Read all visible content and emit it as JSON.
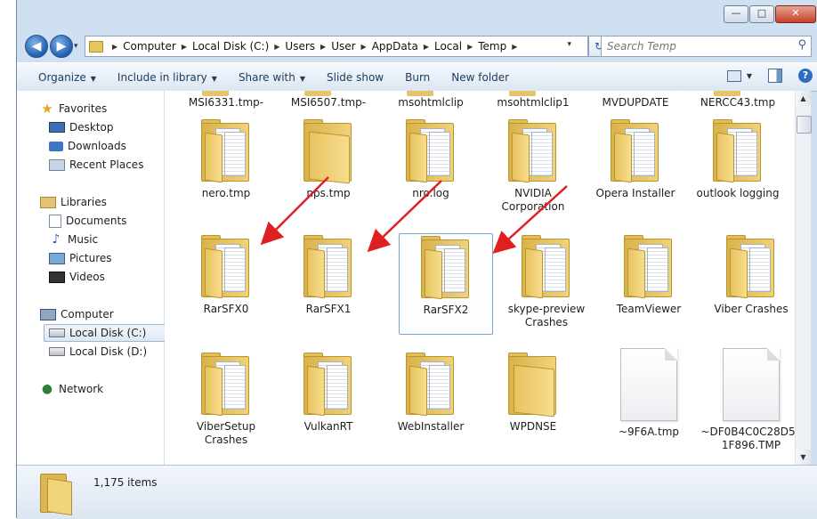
{
  "window": {
    "caption": {
      "minimize": "—",
      "maximize": "□",
      "close": "✕"
    }
  },
  "address": {
    "back_label": "◀",
    "forward_label": "▶",
    "history_label": "▾",
    "breadcrumbs": [
      "Computer",
      "Local Disk (C:)",
      "Users",
      "User",
      "AppData",
      "Local",
      "Temp"
    ],
    "dropdown_label": "▾",
    "refresh_label": "↻"
  },
  "search": {
    "placeholder": "Search Temp"
  },
  "toolbar": {
    "organize": "Organize",
    "include": "Include in library",
    "share": "Share with",
    "slideshow": "Slide show",
    "burn": "Burn",
    "newfolder": "New folder",
    "help": "?"
  },
  "nav": {
    "favorites": "Favorites",
    "desktop": "Desktop",
    "downloads": "Downloads",
    "recent": "Recent Places",
    "libraries": "Libraries",
    "documents": "Documents",
    "music": "Music",
    "pictures": "Pictures",
    "videos": "Videos",
    "computer": "Computer",
    "local_c": "Local Disk (C:)",
    "local_d": "Local Disk (D:)",
    "network": "Network"
  },
  "files": {
    "row0": [
      "MSI6331.tmp-",
      "MSI6507.tmp-",
      "msohtmlclip",
      "msohtmlclip1",
      "MVDUPDATE",
      "NERCC43.tmp"
    ],
    "row1": [
      "nero.tmp",
      "nps.tmp",
      "nro.log",
      "NVIDIA Corporation",
      "Opera Installer",
      "outlook logging"
    ],
    "row2": [
      "RarSFX0",
      "RarSFX1",
      "RarSFX2",
      "skype-preview Crashes",
      "TeamViewer",
      "Viber Crashes"
    ],
    "row3": [
      "ViberSetup Crashes",
      "VulkanRT",
      "WebInstaller",
      "WPDNSE",
      "~9F6A.tmp",
      "~DF0B4C0C28D5F1F896.TMP"
    ]
  },
  "status": {
    "item_count": "1,175 items"
  },
  "colors": {
    "annotation_arrow": "#e02020",
    "selection": "#7da2ce"
  }
}
